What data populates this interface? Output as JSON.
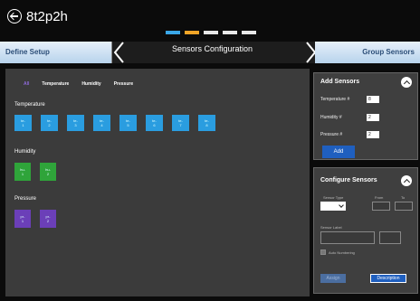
{
  "app": {
    "title": "8t2p2h"
  },
  "progress": {
    "steps": [
      "done",
      "active",
      "todo",
      "todo",
      "todo"
    ]
  },
  "nav": {
    "left_label": "Define Setup",
    "title": "Sensors Configuration",
    "right_label": "Group Sensors"
  },
  "filters": {
    "all": "All",
    "temperature": "Temperature",
    "humidity": "Humidity",
    "pressure": "Pressure"
  },
  "groups": {
    "temperature": {
      "title": "Temperature",
      "tiles": [
        {
          "a": "te-",
          "b": "1"
        },
        {
          "a": "te-",
          "b": "2"
        },
        {
          "a": "te-",
          "b": "3"
        },
        {
          "a": "te-",
          "b": "4"
        },
        {
          "a": "te-",
          "b": "5"
        },
        {
          "a": "te-",
          "b": "6"
        },
        {
          "a": "te-",
          "b": "7"
        },
        {
          "a": "te-",
          "b": "8"
        }
      ]
    },
    "humidity": {
      "title": "Humidity",
      "tiles": [
        {
          "a": "hu-",
          "b": "1"
        },
        {
          "a": "hu-",
          "b": "2"
        }
      ]
    },
    "pressure": {
      "title": "Pressure",
      "tiles": [
        {
          "a": "pr-",
          "b": "1"
        },
        {
          "a": "pr-",
          "b": "2"
        }
      ]
    }
  },
  "add_sensors": {
    "title": "Add Sensors",
    "temperature_label": "Temperature #",
    "temperature_value": "8",
    "humidity_label": "Humidity #",
    "humidity_value": "2",
    "pressure_label": "Pressure #",
    "pressure_value": "2",
    "add_label": "Add"
  },
  "configure": {
    "title": "Configure Sensors",
    "sensor_type_label": "Sensor Type",
    "from_label": "From",
    "to_label": "To",
    "sensor_label_label": "Sensor Label",
    "auto_numbering_label": "Auto Numbering",
    "assign_label": "Assign",
    "description_label": "Description"
  },
  "colors": {
    "temperature": "#2a9de0",
    "humidity": "#2fa43a",
    "pressure": "#6b3fb8",
    "accent": "#1f5fbf"
  }
}
